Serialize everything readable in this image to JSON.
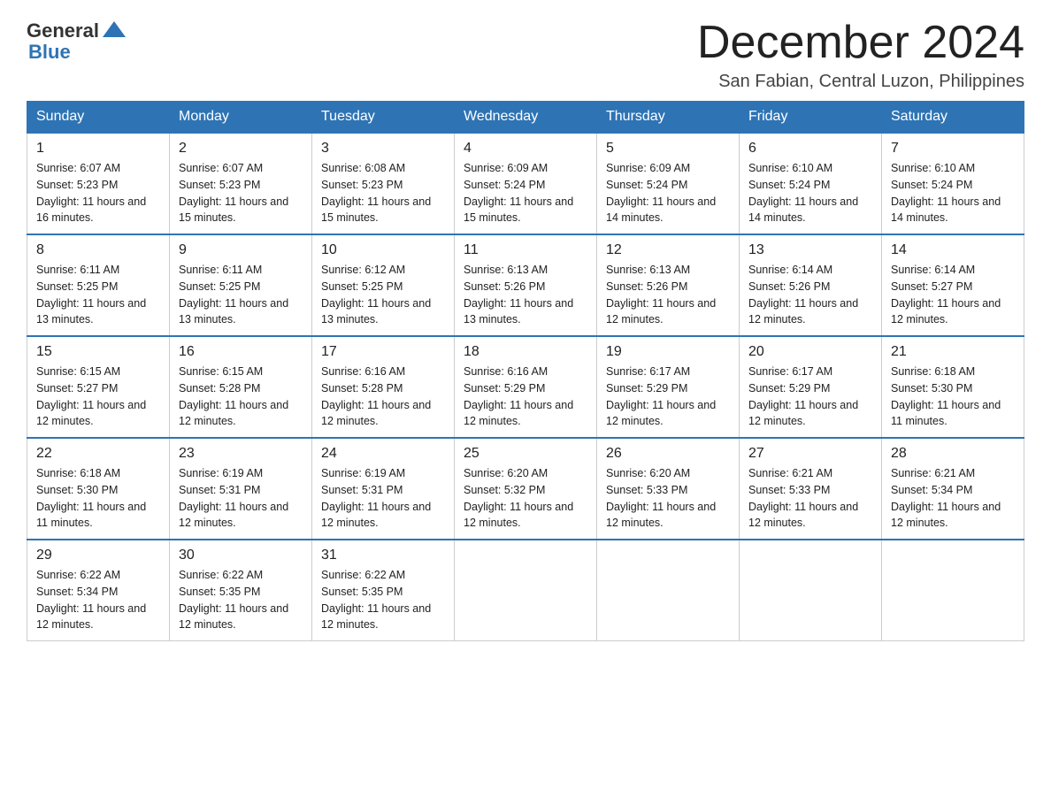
{
  "header": {
    "logo_general": "General",
    "logo_blue": "Blue",
    "month_title": "December 2024",
    "location": "San Fabian, Central Luzon, Philippines"
  },
  "days_of_week": [
    "Sunday",
    "Monday",
    "Tuesday",
    "Wednesday",
    "Thursday",
    "Friday",
    "Saturday"
  ],
  "weeks": [
    [
      {
        "day": "1",
        "sunrise": "Sunrise: 6:07 AM",
        "sunset": "Sunset: 5:23 PM",
        "daylight": "Daylight: 11 hours and 16 minutes."
      },
      {
        "day": "2",
        "sunrise": "Sunrise: 6:07 AM",
        "sunset": "Sunset: 5:23 PM",
        "daylight": "Daylight: 11 hours and 15 minutes."
      },
      {
        "day": "3",
        "sunrise": "Sunrise: 6:08 AM",
        "sunset": "Sunset: 5:23 PM",
        "daylight": "Daylight: 11 hours and 15 minutes."
      },
      {
        "day": "4",
        "sunrise": "Sunrise: 6:09 AM",
        "sunset": "Sunset: 5:24 PM",
        "daylight": "Daylight: 11 hours and 15 minutes."
      },
      {
        "day": "5",
        "sunrise": "Sunrise: 6:09 AM",
        "sunset": "Sunset: 5:24 PM",
        "daylight": "Daylight: 11 hours and 14 minutes."
      },
      {
        "day": "6",
        "sunrise": "Sunrise: 6:10 AM",
        "sunset": "Sunset: 5:24 PM",
        "daylight": "Daylight: 11 hours and 14 minutes."
      },
      {
        "day": "7",
        "sunrise": "Sunrise: 6:10 AM",
        "sunset": "Sunset: 5:24 PM",
        "daylight": "Daylight: 11 hours and 14 minutes."
      }
    ],
    [
      {
        "day": "8",
        "sunrise": "Sunrise: 6:11 AM",
        "sunset": "Sunset: 5:25 PM",
        "daylight": "Daylight: 11 hours and 13 minutes."
      },
      {
        "day": "9",
        "sunrise": "Sunrise: 6:11 AM",
        "sunset": "Sunset: 5:25 PM",
        "daylight": "Daylight: 11 hours and 13 minutes."
      },
      {
        "day": "10",
        "sunrise": "Sunrise: 6:12 AM",
        "sunset": "Sunset: 5:25 PM",
        "daylight": "Daylight: 11 hours and 13 minutes."
      },
      {
        "day": "11",
        "sunrise": "Sunrise: 6:13 AM",
        "sunset": "Sunset: 5:26 PM",
        "daylight": "Daylight: 11 hours and 13 minutes."
      },
      {
        "day": "12",
        "sunrise": "Sunrise: 6:13 AM",
        "sunset": "Sunset: 5:26 PM",
        "daylight": "Daylight: 11 hours and 12 minutes."
      },
      {
        "day": "13",
        "sunrise": "Sunrise: 6:14 AM",
        "sunset": "Sunset: 5:26 PM",
        "daylight": "Daylight: 11 hours and 12 minutes."
      },
      {
        "day": "14",
        "sunrise": "Sunrise: 6:14 AM",
        "sunset": "Sunset: 5:27 PM",
        "daylight": "Daylight: 11 hours and 12 minutes."
      }
    ],
    [
      {
        "day": "15",
        "sunrise": "Sunrise: 6:15 AM",
        "sunset": "Sunset: 5:27 PM",
        "daylight": "Daylight: 11 hours and 12 minutes."
      },
      {
        "day": "16",
        "sunrise": "Sunrise: 6:15 AM",
        "sunset": "Sunset: 5:28 PM",
        "daylight": "Daylight: 11 hours and 12 minutes."
      },
      {
        "day": "17",
        "sunrise": "Sunrise: 6:16 AM",
        "sunset": "Sunset: 5:28 PM",
        "daylight": "Daylight: 11 hours and 12 minutes."
      },
      {
        "day": "18",
        "sunrise": "Sunrise: 6:16 AM",
        "sunset": "Sunset: 5:29 PM",
        "daylight": "Daylight: 11 hours and 12 minutes."
      },
      {
        "day": "19",
        "sunrise": "Sunrise: 6:17 AM",
        "sunset": "Sunset: 5:29 PM",
        "daylight": "Daylight: 11 hours and 12 minutes."
      },
      {
        "day": "20",
        "sunrise": "Sunrise: 6:17 AM",
        "sunset": "Sunset: 5:29 PM",
        "daylight": "Daylight: 11 hours and 12 minutes."
      },
      {
        "day": "21",
        "sunrise": "Sunrise: 6:18 AM",
        "sunset": "Sunset: 5:30 PM",
        "daylight": "Daylight: 11 hours and 11 minutes."
      }
    ],
    [
      {
        "day": "22",
        "sunrise": "Sunrise: 6:18 AM",
        "sunset": "Sunset: 5:30 PM",
        "daylight": "Daylight: 11 hours and 11 minutes."
      },
      {
        "day": "23",
        "sunrise": "Sunrise: 6:19 AM",
        "sunset": "Sunset: 5:31 PM",
        "daylight": "Daylight: 11 hours and 12 minutes."
      },
      {
        "day": "24",
        "sunrise": "Sunrise: 6:19 AM",
        "sunset": "Sunset: 5:31 PM",
        "daylight": "Daylight: 11 hours and 12 minutes."
      },
      {
        "day": "25",
        "sunrise": "Sunrise: 6:20 AM",
        "sunset": "Sunset: 5:32 PM",
        "daylight": "Daylight: 11 hours and 12 minutes."
      },
      {
        "day": "26",
        "sunrise": "Sunrise: 6:20 AM",
        "sunset": "Sunset: 5:33 PM",
        "daylight": "Daylight: 11 hours and 12 minutes."
      },
      {
        "day": "27",
        "sunrise": "Sunrise: 6:21 AM",
        "sunset": "Sunset: 5:33 PM",
        "daylight": "Daylight: 11 hours and 12 minutes."
      },
      {
        "day": "28",
        "sunrise": "Sunrise: 6:21 AM",
        "sunset": "Sunset: 5:34 PM",
        "daylight": "Daylight: 11 hours and 12 minutes."
      }
    ],
    [
      {
        "day": "29",
        "sunrise": "Sunrise: 6:22 AM",
        "sunset": "Sunset: 5:34 PM",
        "daylight": "Daylight: 11 hours and 12 minutes."
      },
      {
        "day": "30",
        "sunrise": "Sunrise: 6:22 AM",
        "sunset": "Sunset: 5:35 PM",
        "daylight": "Daylight: 11 hours and 12 minutes."
      },
      {
        "day": "31",
        "sunrise": "Sunrise: 6:22 AM",
        "sunset": "Sunset: 5:35 PM",
        "daylight": "Daylight: 11 hours and 12 minutes."
      },
      null,
      null,
      null,
      null
    ]
  ]
}
